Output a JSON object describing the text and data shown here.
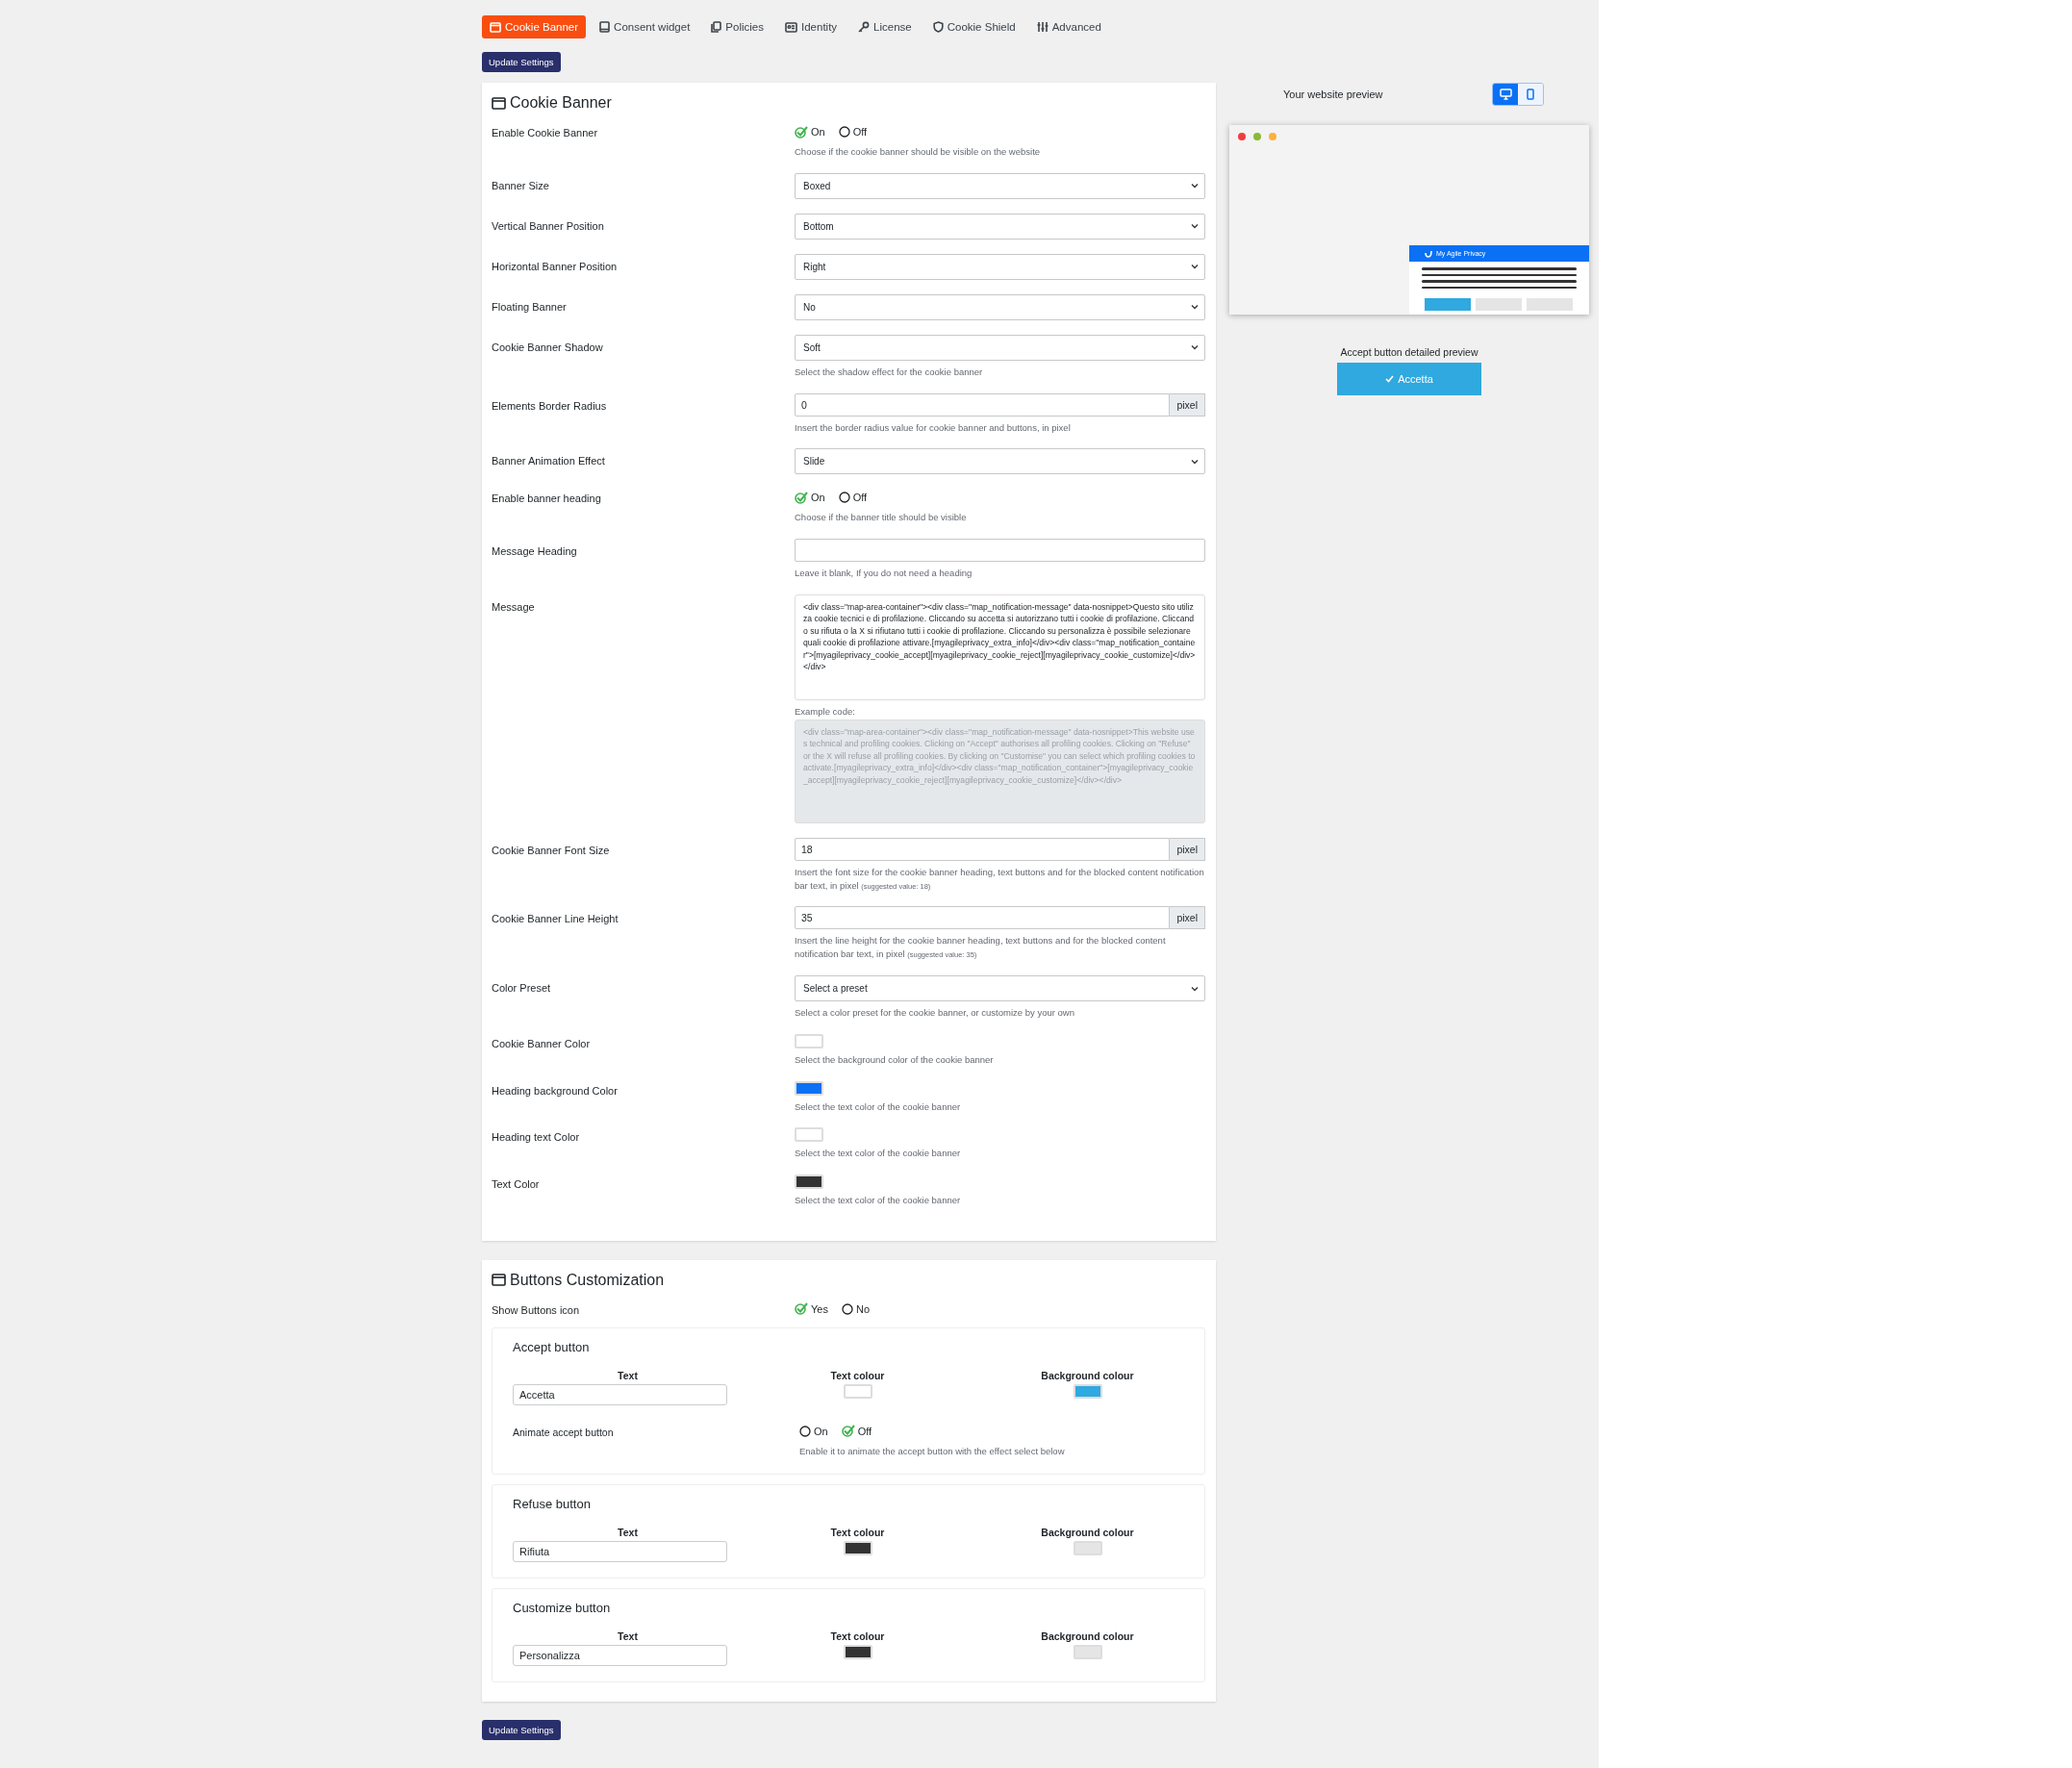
{
  "tabs": [
    {
      "label": "Cookie Banner",
      "selected": true
    },
    {
      "label": "Consent widget",
      "selected": false
    },
    {
      "label": "Policies",
      "selected": false
    },
    {
      "label": "Identity",
      "selected": false
    },
    {
      "label": "License",
      "selected": false
    },
    {
      "label": "Cookie Shield",
      "selected": false
    },
    {
      "label": "Advanced",
      "selected": false
    }
  ],
  "update_button_top": "Update Settings",
  "cookie_banner": {
    "title": "Cookie Banner",
    "rows": [
      {
        "kind": "radio",
        "label": "Enable Cookie Banner",
        "options": [
          {
            "label": "On",
            "selected": true
          },
          {
            "label": "Off",
            "selected": false
          }
        ],
        "help": "Choose if the cookie banner should be visible on the website"
      },
      {
        "kind": "select",
        "label": "Banner Size",
        "value": "Boxed"
      },
      {
        "kind": "select",
        "label": "Vertical Banner Position",
        "value": "Bottom"
      },
      {
        "kind": "select",
        "label": "Horizontal Banner Position",
        "value": "Right"
      },
      {
        "kind": "select",
        "label": "Floating Banner",
        "value": "No"
      },
      {
        "kind": "select",
        "label": "Cookie Banner Shadow",
        "value": "Soft",
        "help": "Select the shadow effect for the cookie banner"
      },
      {
        "kind": "unit",
        "label": "Elements Border Radius",
        "value": "0",
        "unit": "pixel",
        "help": "Insert the border radius value for cookie banner and buttons, in pixel"
      },
      {
        "kind": "select",
        "label": "Banner Animation Effect",
        "value": "Slide"
      },
      {
        "kind": "radio",
        "label": "Enable banner heading",
        "options": [
          {
            "label": "On",
            "selected": true
          },
          {
            "label": "Off",
            "selected": false
          }
        ],
        "help": "Choose if the banner title should be visible"
      },
      {
        "kind": "text",
        "label": "Message Heading",
        "help": "Leave it blank, If you do not need a heading"
      },
      {
        "kind": "message",
        "label": "Message",
        "value": "<div class=\"map-area-container\"><div class=\"map_notification-message\" data-nosnippet>Questo sito utilizza cookie tecnici e di profilazione. Cliccando su accetta si autorizzano tutti i cookie di profilazione. Cliccando su rifiuta o la X si rifiutano tutti i cookie di profilazione. Cliccando su personalizza è possibile selezionare quali cookie di profilazione attivare.[myagileprivacy_extra_info]</div><div class=\"map_notification_container\">[myagileprivacy_cookie_accept][myagileprivacy_cookie_reject][myagileprivacy_cookie_customize]</div></div>",
        "example_label": "Example code:",
        "example": "<div class=\"map-area-container\"><div class=\"map_notification-message\" data-nosnippet>This website uses technical and profiling cookies. Clicking on \"Accept\" authorises all profiling cookies. Clicking on \"Refuse\" or the X will refuse all profiling cookies. By clicking on \"Customise\" you can select which profiling cookies to activate.[myagileprivacy_extra_info]</div><div class=\"map_notification_container\">[myagileprivacy_cookie_accept][myagileprivacy_cookie_reject][myagileprivacy_cookie_customize]</div></div>"
      },
      {
        "kind": "unit",
        "label": "Cookie Banner Font Size",
        "value": "18",
        "unit": "pixel",
        "help": "Insert the font size for the cookie banner heading, text buttons and for the blocked content notification bar text, in pixel",
        "note": "(suggested value: 18)"
      },
      {
        "kind": "unit",
        "label": "Cookie Banner Line Height",
        "value": "35",
        "unit": "pixel",
        "help": "Insert the line height for the cookie banner heading, text buttons and for the blocked content notification bar text, in pixel",
        "note": "(suggested value: 35)"
      },
      {
        "kind": "select",
        "label": "Color Preset",
        "value": "Select a preset",
        "help": "Select a color preset for the cookie banner, or customize by your own"
      },
      {
        "kind": "color",
        "label": "Cookie Banner Color",
        "color": "#ffffff",
        "help": "Select the background color of the cookie banner"
      },
      {
        "kind": "color",
        "label": "Heading background Color",
        "color": "#0a71f5",
        "help": "Select the text color of the cookie banner"
      },
      {
        "kind": "color",
        "label": "Heading text Color",
        "color": "#ffffff",
        "help": "Select the text color of the cookie banner"
      },
      {
        "kind": "color",
        "label": "Text Color",
        "color": "#333333",
        "help": "Select the text color of the cookie banner"
      }
    ]
  },
  "buttons_customization": {
    "title": "Buttons Customization",
    "show_icon": {
      "label": "Show Buttons icon",
      "options": [
        {
          "label": "Yes",
          "selected": true
        },
        {
          "label": "No",
          "selected": false
        }
      ]
    },
    "groups": [
      {
        "title": "Accept button",
        "fields": [
          {
            "kind": "text",
            "label": "Text",
            "value": "Accetta"
          },
          {
            "kind": "swatch",
            "label": "Text colour",
            "color": "#ffffff"
          },
          {
            "kind": "swatch",
            "label": "Background colour",
            "color": "#2fa9e0"
          }
        ],
        "animate": {
          "label": "Animate accept button",
          "options": [
            {
              "label": "On",
              "selected": false
            },
            {
              "label": "Off",
              "selected": true
            }
          ],
          "help": "Enable it to animate the accept button with the effect select below"
        }
      },
      {
        "title": "Refuse button",
        "fields": [
          {
            "kind": "text",
            "label": "Text",
            "value": "Rifiuta"
          },
          {
            "kind": "swatch",
            "label": "Text colour",
            "color": "#333333"
          },
          {
            "kind": "swatch",
            "label": "Background colour",
            "color": "#e5e5e5"
          }
        ]
      },
      {
        "title": "Customize button",
        "fields": [
          {
            "kind": "text",
            "label": "Text",
            "value": "Personalizza"
          },
          {
            "kind": "swatch",
            "label": "Text colour",
            "color": "#333333"
          },
          {
            "kind": "swatch",
            "label": "Background colour",
            "color": "#e5e5e5"
          }
        ]
      }
    ]
  },
  "update_button_bottom": "Update Settings",
  "preview": {
    "title": "Your website preview",
    "devices": [
      {
        "selected": true
      },
      {
        "selected": false
      }
    ],
    "banner_title": "My Agile Privacy",
    "accept_title": "Accept button detailed preview",
    "accept_label": "Accetta"
  }
}
